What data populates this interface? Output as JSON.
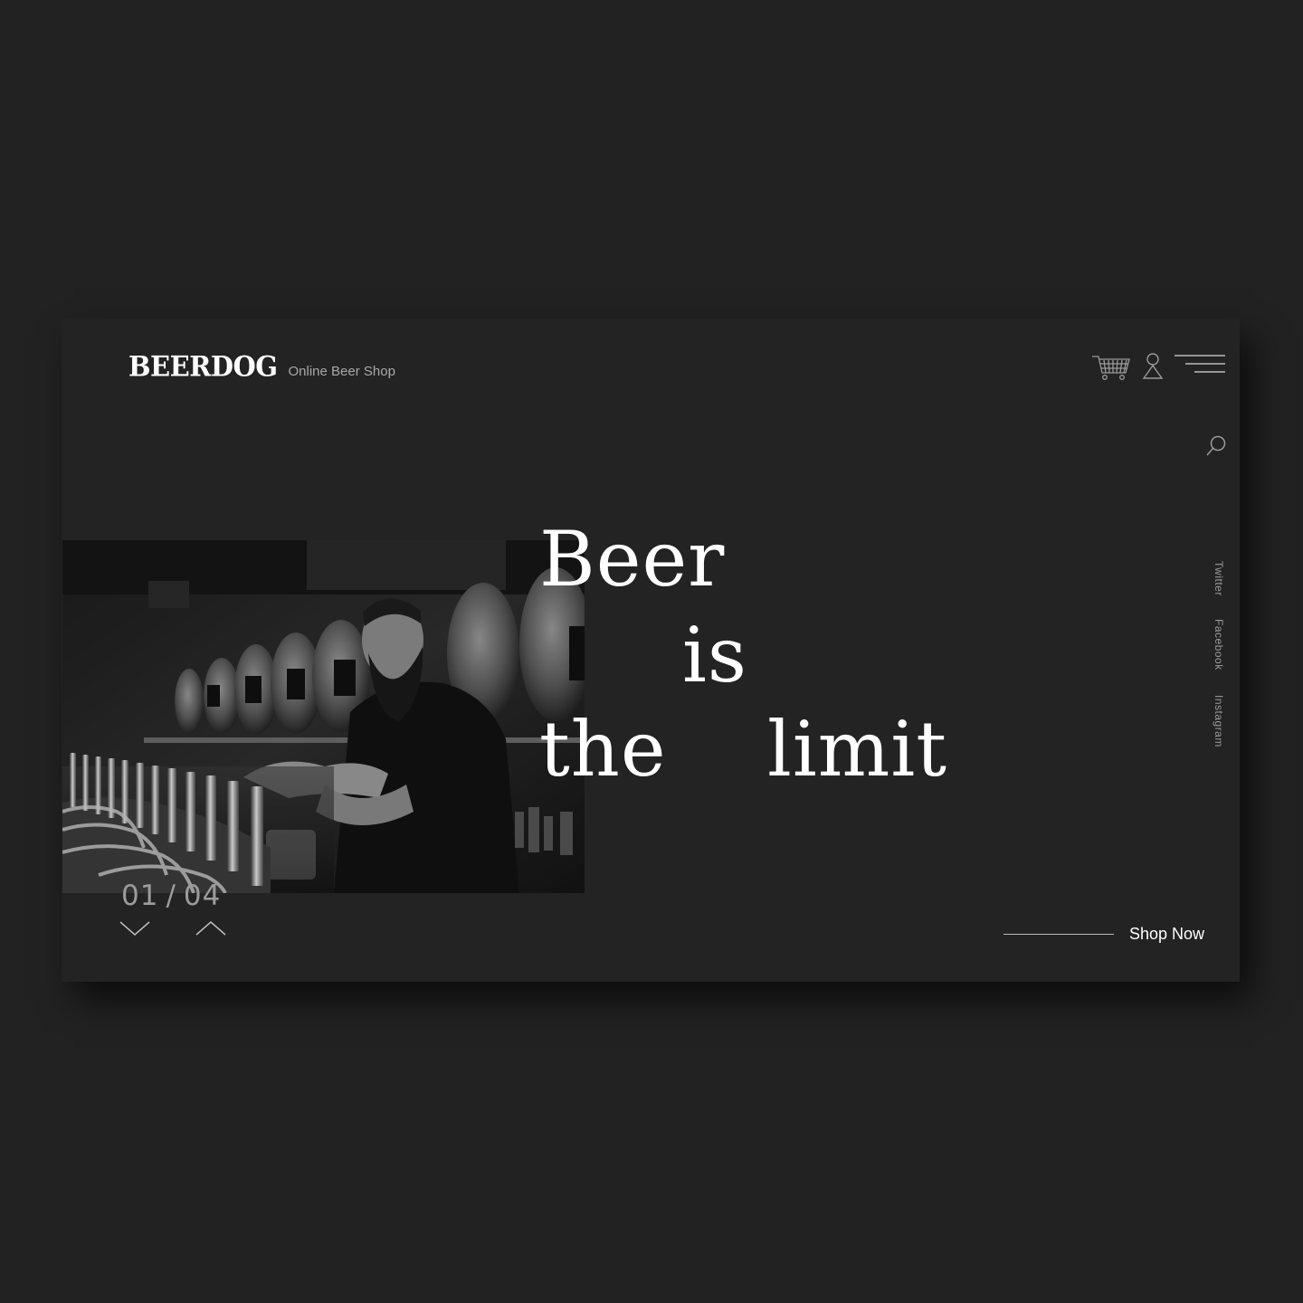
{
  "brand": {
    "logo": "BEERDOG",
    "tagline": "Online Beer Shop"
  },
  "header": {
    "icons": [
      "cart-icon",
      "user-icon",
      "menu-icon",
      "search-icon"
    ]
  },
  "hero": {
    "headline": {
      "w1": "Beer",
      "w2": "is",
      "w3": "the",
      "w4": "limit"
    },
    "image": "bartender-pouring-beer-photo"
  },
  "social": {
    "twitter": "Twitter",
    "facebook": "Facebook",
    "instagram": "Instagram"
  },
  "slider": {
    "current": "01",
    "separator": "/",
    "total": "04"
  },
  "cta": {
    "label": "Shop Now"
  },
  "colors": {
    "page_bg": "#222222",
    "card_bg": "#232323",
    "text": "#ffffff",
    "muted": "#9c9c9c"
  }
}
